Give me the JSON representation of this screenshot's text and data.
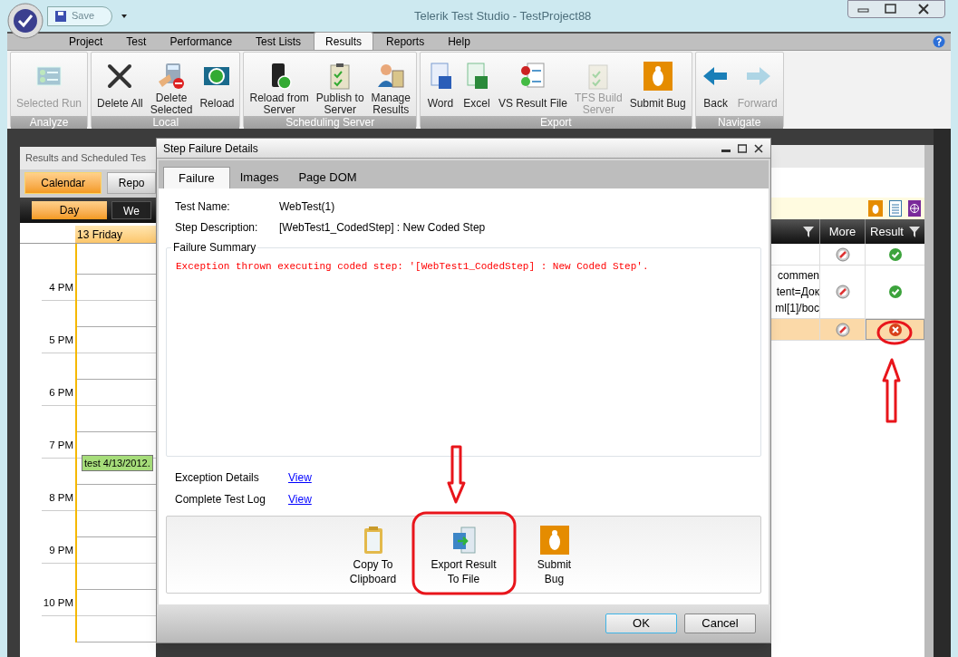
{
  "window": {
    "title": "Telerik Test Studio - TestProject88",
    "save_label": "Save"
  },
  "ribbon": {
    "tabs": [
      {
        "label": "Project",
        "selected": false
      },
      {
        "label": "Test",
        "selected": false
      },
      {
        "label": "Performance",
        "selected": false
      },
      {
        "label": "Test Lists",
        "selected": false
      },
      {
        "label": "Results",
        "selected": true
      },
      {
        "label": "Reports",
        "selected": false
      },
      {
        "label": "Help",
        "selected": false
      }
    ],
    "groups": [
      {
        "name": "Analyze",
        "buttons": [
          {
            "label": [
              "Selected Run"
            ],
            "disabled": true
          }
        ]
      },
      {
        "name": "Local",
        "buttons": [
          {
            "label": [
              "Delete All"
            ],
            "disabled": false
          },
          {
            "label": [
              "Delete",
              "Selected"
            ],
            "disabled": false
          },
          {
            "label": [
              "Reload"
            ],
            "disabled": false
          }
        ]
      },
      {
        "name": "Scheduling Server",
        "buttons": [
          {
            "label": [
              "Reload from",
              "Server"
            ],
            "disabled": false
          },
          {
            "label": [
              "Publish to",
              "Server"
            ],
            "disabled": false
          },
          {
            "label": [
              "Manage",
              "Results"
            ],
            "disabled": false
          }
        ]
      },
      {
        "name": "Export",
        "buttons": [
          {
            "label": [
              "Word"
            ],
            "disabled": false
          },
          {
            "label": [
              "Excel"
            ],
            "disabled": false
          },
          {
            "label": [
              "VS Result File"
            ],
            "disabled": false
          },
          {
            "label": [
              "TFS Build",
              "Server"
            ],
            "disabled": true
          },
          {
            "label": [
              "Submit Bug"
            ],
            "disabled": false
          }
        ]
      },
      {
        "name": "Navigate",
        "buttons": [
          {
            "label": [
              "Back"
            ],
            "disabled": false
          },
          {
            "label": [
              "Forward"
            ],
            "disabled": true
          }
        ]
      }
    ]
  },
  "results_panel": {
    "title": "Results and Scheduled Tes",
    "view_tabs": [
      {
        "label": "Calendar",
        "selected": true
      },
      {
        "label": "Repo",
        "selected": false
      }
    ],
    "range_tabs": [
      {
        "label": "Day",
        "selected": true
      },
      {
        "label": "We",
        "selected": false
      }
    ],
    "day_header": "13 Friday",
    "hours": [
      {
        "label": "4 PM"
      },
      {
        "label": "5 PM"
      },
      {
        "label": "6 PM"
      },
      {
        "label": "7 PM",
        "appointment": "test 4/13/2012."
      },
      {
        "label": "8 PM"
      },
      {
        "label": "9 PM"
      },
      {
        "label": "10 PM"
      }
    ]
  },
  "grid": {
    "columns": [
      "More",
      "Result"
    ],
    "rows": [
      {
        "text": [],
        "failed": false,
        "selected": false
      },
      {
        "text": [
          "commen",
          "tent=Док",
          "ml[1]/boc"
        ],
        "failed": false,
        "selected": false
      },
      {
        "text": [],
        "failed": true,
        "selected": true
      }
    ]
  },
  "dialog": {
    "title": "Step Failure Details",
    "tabs": [
      {
        "label": "Failure",
        "selected": true
      },
      {
        "label": "Images",
        "selected": false
      },
      {
        "label": "Page DOM",
        "selected": false
      }
    ],
    "fields": [
      {
        "label": "Test Name:",
        "value": "WebTest(1)"
      },
      {
        "label": "Step Description:",
        "value": "[WebTest1_CodedStep] : New Coded Step"
      }
    ],
    "summary_title": "Failure Summary",
    "summary": "Exception thrown executing coded step: '[WebTest1_CodedStep] : New Coded Step'.",
    "links": [
      {
        "label": "Exception Details",
        "link": "View"
      },
      {
        "label": "Complete Test Log",
        "link": "View"
      }
    ],
    "actions": [
      {
        "label": [
          "Copy To",
          "Clipboard"
        ]
      },
      {
        "label": [
          "Export Result",
          "To File"
        ]
      },
      {
        "label": [
          "Submit",
          "Bug"
        ]
      }
    ],
    "buttons": [
      {
        "label": "OK",
        "default": true
      },
      {
        "label": "Cancel",
        "default": false
      }
    ]
  }
}
